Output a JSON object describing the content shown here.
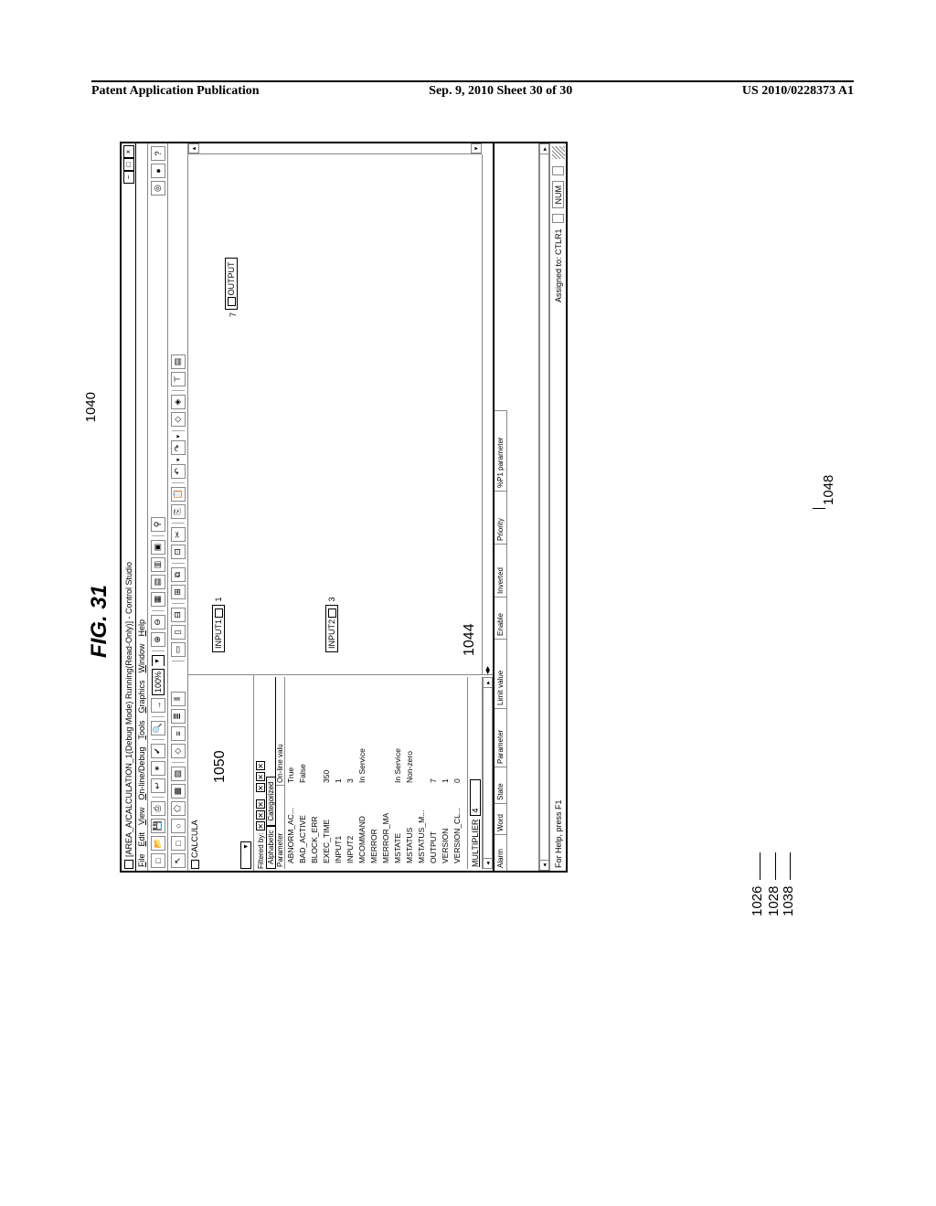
{
  "page_header": {
    "left": "Patent Application Publication",
    "center": "Sep. 9, 2010  Sheet 30 of 30",
    "right": "US 2010/0228373 A1"
  },
  "figure_label": "FIG. 31",
  "callouts": {
    "c1040": "1040",
    "c1050": "1050",
    "c1044": "1044",
    "c1026": "1026",
    "c1028": "1028",
    "c1038": "1038",
    "c1048": "1048"
  },
  "window": {
    "title": "[AREA_A/CALCULATION_1(Debug Mode) Running(Read-Only)] - Control Studio",
    "menus": [
      "File",
      "Edit",
      "View",
      "On-line/Debug",
      "Tools",
      "Graphics",
      "Window",
      "Help"
    ],
    "zoom": "100%",
    "hierarchy_item": "CALCULA",
    "filter_label": "Filtered by:",
    "tabs": [
      "Alphabetic",
      "Categorized"
    ],
    "param_header": {
      "col1": "Parameter",
      "col2": "On-line valu"
    },
    "parameters": [
      {
        "name": "ABNORM_AC...",
        "value": "True"
      },
      {
        "name": "BAD_ACTIVE",
        "value": "False"
      },
      {
        "name": "BLOCK_ERR",
        "value": ""
      },
      {
        "name": "EXEC_TIME",
        "value": "350"
      },
      {
        "name": "INPUT1",
        "value": "1"
      },
      {
        "name": "INPUT2",
        "value": "3"
      },
      {
        "name": "MCOMMAND",
        "value": "In Service"
      },
      {
        "name": "MERROR",
        "value": ""
      },
      {
        "name": "MERROR_MA",
        "value": ""
      },
      {
        "name": "MSTATE",
        "value": "In Service"
      },
      {
        "name": "MSTATUS",
        "value": "Non-zero"
      },
      {
        "name": "MSTATUS_M...",
        "value": ""
      },
      {
        "name": "OUTPUT",
        "value": "7"
      },
      {
        "name": "VERSION",
        "value": "1"
      },
      {
        "name": "VERSION_CL...",
        "value": "0"
      }
    ],
    "multiplier_label": "MULTIPLIER",
    "multiplier_value": "4",
    "blocks": {
      "input1": {
        "label": "INPUT1",
        "num": "1"
      },
      "input2": {
        "label": "INPUT2",
        "num": "3"
      },
      "output": {
        "label": "OUTPUT",
        "num": "7"
      }
    },
    "alarm_columns": [
      "Alarm",
      "Word",
      "State",
      "Parameter",
      "Limit value",
      "Enable",
      "Inverted",
      "Priority",
      "%P1 parameter"
    ],
    "status_left": "For Help, press F1",
    "status_assigned": "Assigned to: CTLR1",
    "status_num": "NUM"
  },
  "chart_data": {
    "type": "table",
    "title": "CALCULATION_1 parameters (On-line values, Debug Mode)",
    "columns": [
      "Parameter",
      "On-line value"
    ],
    "rows": [
      [
        "ABNORM_AC...",
        "True"
      ],
      [
        "BAD_ACTIVE",
        "False"
      ],
      [
        "BLOCK_ERR",
        ""
      ],
      [
        "EXEC_TIME",
        350
      ],
      [
        "INPUT1",
        1
      ],
      [
        "INPUT2",
        3
      ],
      [
        "MCOMMAND",
        "In Service"
      ],
      [
        "MERROR",
        ""
      ],
      [
        "MERROR_MA",
        ""
      ],
      [
        "MSTATE",
        "In Service"
      ],
      [
        "MSTATUS",
        "Non-zero"
      ],
      [
        "MSTATUS_M...",
        ""
      ],
      [
        "OUTPUT",
        7
      ],
      [
        "VERSION",
        1
      ],
      [
        "VERSION_CL...",
        0
      ],
      [
        "MULTIPLIER",
        4
      ]
    ]
  }
}
